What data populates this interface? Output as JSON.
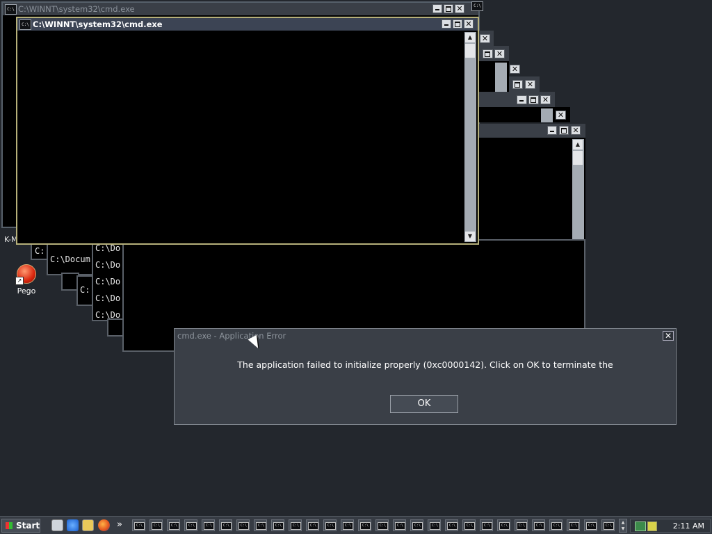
{
  "windows": {
    "back_title": "C:\\WINNT\\system32\\cmd.exe",
    "front_title": "C:\\WINNT\\system32\\cmd.exe",
    "icon_text": "C:\\"
  },
  "console_fragments": {
    "prompt_c": "C:",
    "prompt_docum": "C:\\Docum",
    "prompt_c2": "C:",
    "prompt_do_1": "C:\\Do",
    "prompt_do_2": "C:\\Do",
    "prompt_do_3": "C:\\Do",
    "prompt_do_4": "C:\\Do",
    "prompt_do_5": "C:\\Do",
    "edge_label": "K-M"
  },
  "desktop_icon": {
    "label": "Pego"
  },
  "dialog": {
    "title": "cmd.exe - Application Error",
    "message": "The application failed to initialize properly (0xc0000142). Click on OK to terminate the",
    "ok_label": "OK",
    "close_glyph": "✕"
  },
  "taskbar": {
    "start_label": "Start",
    "more_glyph": "»",
    "clock": "2:11 AM",
    "task_count": 28
  }
}
